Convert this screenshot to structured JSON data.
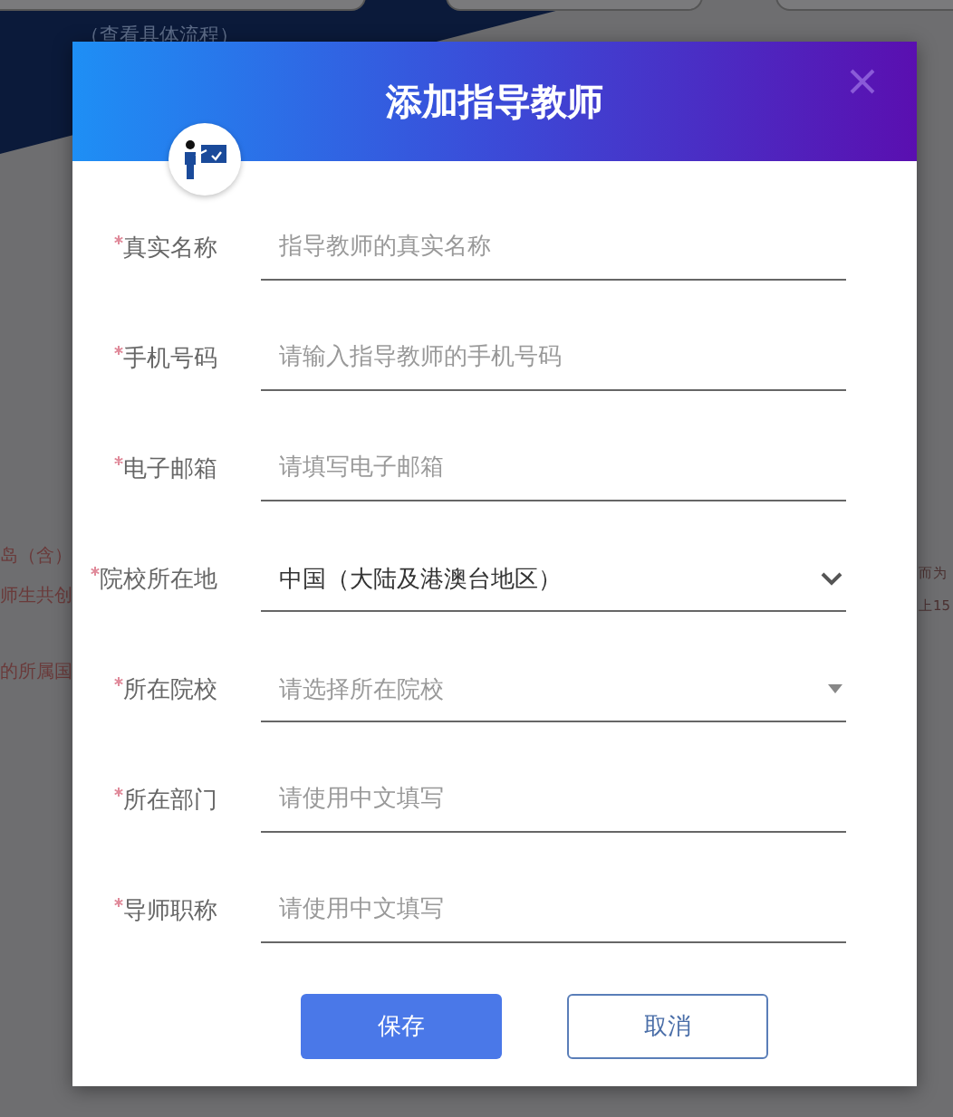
{
  "background": {
    "link": "（查看具体流程）",
    "left_fragments": [
      "岛（含）",
      "师生共创",
      "的所属国"
    ],
    "right_fragments": [
      "而为",
      "上15"
    ]
  },
  "dialog": {
    "title": "添加指导教师",
    "fields": [
      {
        "label": "真实名称",
        "required": true,
        "kind": "text",
        "placeholder": "指导教师的真实名称"
      },
      {
        "label": "手机号码",
        "required": true,
        "kind": "text",
        "placeholder": "请输入指导教师的手机号码"
      },
      {
        "label": "电子邮箱",
        "required": true,
        "kind": "text",
        "placeholder": "请填写电子邮箱"
      },
      {
        "label": "院校所在地",
        "required": true,
        "kind": "dropdown",
        "value": "中国（大陆及港澳台地区）"
      },
      {
        "label": "所在院校",
        "required": true,
        "kind": "combo",
        "placeholder": "请选择所在院校"
      },
      {
        "label": "所在部门",
        "required": true,
        "kind": "text",
        "placeholder": "请使用中文填写"
      },
      {
        "label": "导师职称",
        "required": true,
        "kind": "text",
        "placeholder": "请使用中文填写"
      }
    ],
    "buttons": [
      {
        "label": "保存",
        "kind": "primary"
      },
      {
        "label": "取消",
        "kind": "secondary"
      }
    ]
  }
}
